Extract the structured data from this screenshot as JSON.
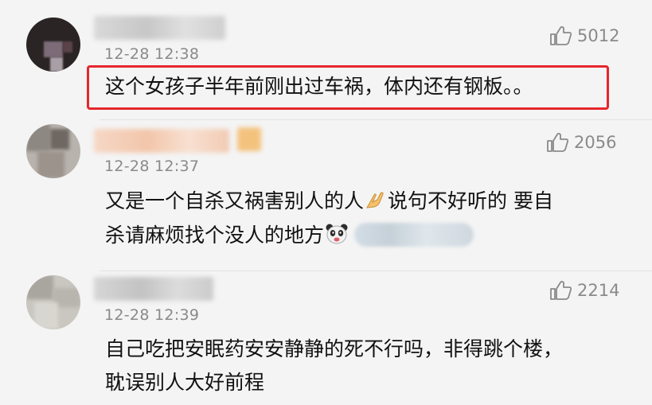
{
  "comments": [
    {
      "timestamp": "12-28 12:38",
      "likes": "5012",
      "text": "这个女孩子半年前刚出过车祸，体内还有钢板。。",
      "highlighted": true
    },
    {
      "timestamp": "12-28 12:37",
      "likes": "2056",
      "line1_a": "又是一个自杀又祸害别人的人",
      "line1_b": "说句不好听的 要自",
      "line2": "杀请麻烦找个没人的地方",
      "emoji_1": "praying-hands-icon",
      "emoji_2": "panda-face-icon"
    },
    {
      "timestamp": "12-28 12:39",
      "likes": "2214",
      "line1": "自己吃把安眠药安安静静的死不行吗，非得跳个楼，",
      "line2": "耽误别人大好前程"
    }
  ],
  "colors": {
    "highlight_border": "#e6262c",
    "meta_gray": "#8a8a8a",
    "text": "#111111",
    "background": "#f4f4f4"
  },
  "icons": {
    "like": "thumbs-up-icon"
  }
}
